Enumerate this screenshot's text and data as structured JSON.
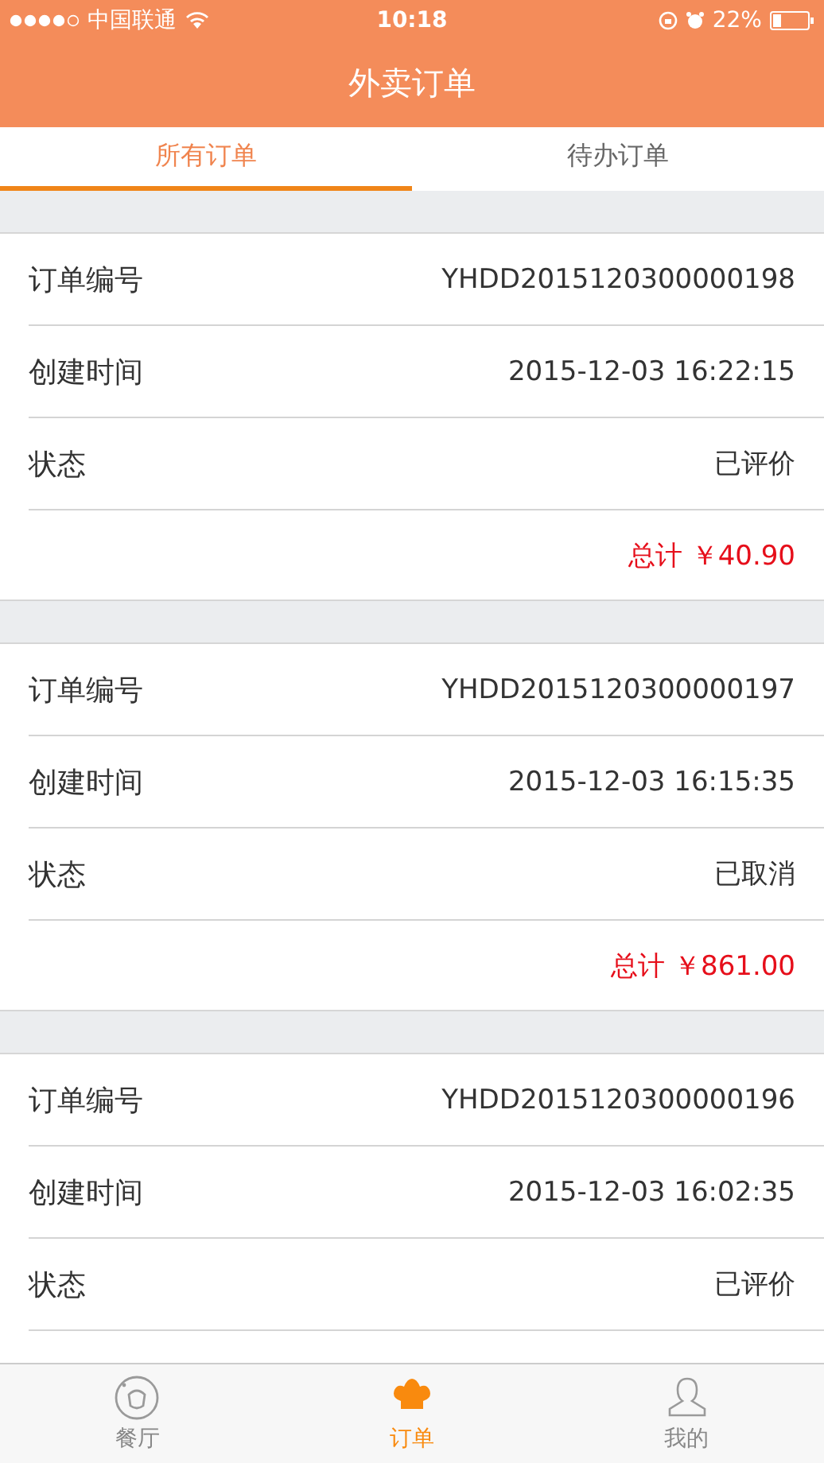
{
  "status_bar": {
    "carrier": "中国联通",
    "time": "10:18",
    "battery": "22%"
  },
  "header": {
    "title": "外卖订单"
  },
  "tabs": [
    {
      "label": "所有订单",
      "selected": true
    },
    {
      "label": "待办订单",
      "selected": false
    }
  ],
  "orders": [
    {
      "rows": [
        {
          "label": "订单编号",
          "value": "YHDD2015120300000198"
        },
        {
          "label": "创建时间",
          "value": "2015-12-03 16:22:15"
        },
        {
          "label": "状态",
          "value": "已评价"
        }
      ],
      "total": "总计 ￥40.90"
    },
    {
      "rows": [
        {
          "label": "订单编号",
          "value": "YHDD2015120300000197"
        },
        {
          "label": "创建时间",
          "value": "2015-12-03 16:15:35"
        },
        {
          "label": "状态",
          "value": "已取消"
        }
      ],
      "total": "总计 ￥861.00"
    },
    {
      "rows": [
        {
          "label": "订单编号",
          "value": "YHDD2015120300000196"
        },
        {
          "label": "创建时间",
          "value": "2015-12-03 16:02:35"
        },
        {
          "label": "状态",
          "value": "已评价"
        }
      ]
    }
  ],
  "tab_bar": [
    {
      "kind": "restaurant",
      "label": "餐厅",
      "selected": false
    },
    {
      "kind": "orders",
      "label": "订单",
      "selected": true
    },
    {
      "kind": "profile",
      "label": "我的",
      "selected": false
    }
  ]
}
